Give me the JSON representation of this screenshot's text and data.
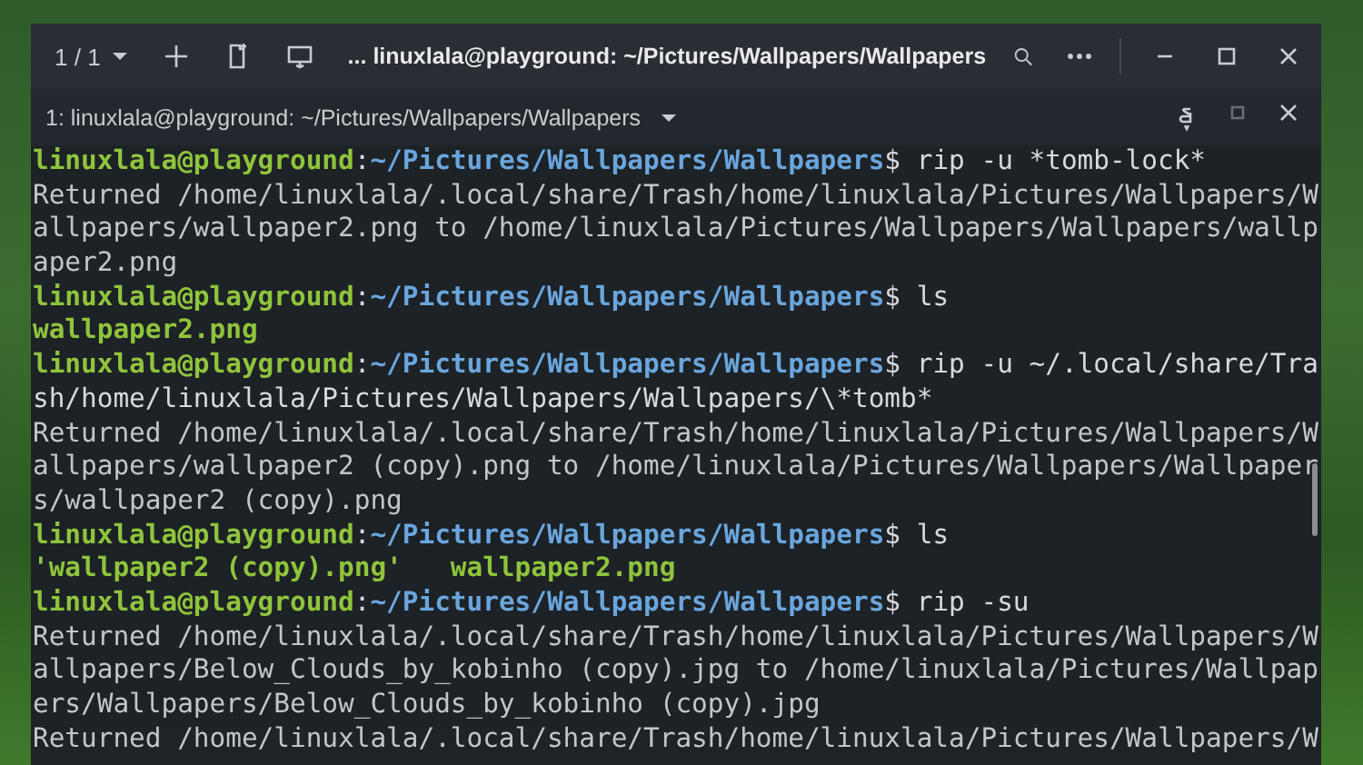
{
  "window": {
    "tab_counter": "1 / 1",
    "title": "... linuxlala@playground: ~/Pictures/Wallpapers/Wallpapers"
  },
  "tabs": [
    {
      "label": "1: linuxlala@playground: ~/Pictures/Wallpapers/Wallpapers",
      "selected": true
    }
  ],
  "terminal": {
    "lines": [
      [
        {
          "kind": "user",
          "text": "linuxlala@playground"
        },
        {
          "kind": "plain",
          "text": ":"
        },
        {
          "kind": "path",
          "text": "~/Pictures/Wallpapers/Wallpapers"
        },
        {
          "kind": "plain",
          "text": "$ rip -u *tomb-lock*"
        }
      ],
      [
        {
          "kind": "output",
          "text": "Returned /home/linuxlala/.local/share/Trash/home/linuxlala/Pictures/Wallpapers/W"
        }
      ],
      [
        {
          "kind": "output",
          "text": "allpapers/wallpaper2.png to /home/linuxlala/Pictures/Wallpapers/Wallpapers/wallp"
        }
      ],
      [
        {
          "kind": "output",
          "text": "aper2.png"
        }
      ],
      [
        {
          "kind": "user",
          "text": "linuxlala@playground"
        },
        {
          "kind": "plain",
          "text": ":"
        },
        {
          "kind": "path",
          "text": "~/Pictures/Wallpapers/Wallpapers"
        },
        {
          "kind": "plain",
          "text": "$ ls"
        }
      ],
      [
        {
          "kind": "file",
          "text": "wallpaper2.png"
        }
      ],
      [
        {
          "kind": "user",
          "text": "linuxlala@playground"
        },
        {
          "kind": "plain",
          "text": ":"
        },
        {
          "kind": "path",
          "text": "~/Pictures/Wallpapers/Wallpapers"
        },
        {
          "kind": "plain",
          "text": "$ rip -u ~/.local/share/Tra"
        }
      ],
      [
        {
          "kind": "plain",
          "text": "sh/home/linuxlala/Pictures/Wallpapers/Wallpapers/\\*tomb*"
        }
      ],
      [
        {
          "kind": "output",
          "text": "Returned /home/linuxlala/.local/share/Trash/home/linuxlala/Pictures/Wallpapers/W"
        }
      ],
      [
        {
          "kind": "output",
          "text": "allpapers/wallpaper2 (copy).png to /home/linuxlala/Pictures/Wallpapers/Wallpaper"
        }
      ],
      [
        {
          "kind": "output",
          "text": "s/wallpaper2 (copy).png"
        }
      ],
      [
        {
          "kind": "user",
          "text": "linuxlala@playground"
        },
        {
          "kind": "plain",
          "text": ":"
        },
        {
          "kind": "path",
          "text": "~/Pictures/Wallpapers/Wallpapers"
        },
        {
          "kind": "plain",
          "text": "$ ls"
        }
      ],
      [
        {
          "kind": "file",
          "text": "'wallpaper2 (copy).png'   wallpaper2.png"
        }
      ],
      [
        {
          "kind": "user",
          "text": "linuxlala@playground"
        },
        {
          "kind": "plain",
          "text": ":"
        },
        {
          "kind": "path",
          "text": "~/Pictures/Wallpapers/Wallpapers"
        },
        {
          "kind": "plain",
          "text": "$ rip -su"
        }
      ],
      [
        {
          "kind": "output",
          "text": "Returned /home/linuxlala/.local/share/Trash/home/linuxlala/Pictures/Wallpapers/W"
        }
      ],
      [
        {
          "kind": "output",
          "text": "allpapers/Below_Clouds_by_kobinho (copy).jpg to /home/linuxlala/Pictures/Wallpap"
        }
      ],
      [
        {
          "kind": "output",
          "text": "ers/Wallpapers/Below_Clouds_by_kobinho (copy).jpg"
        }
      ],
      [
        {
          "kind": "output",
          "text": "Returned /home/linuxlala/.local/share/Trash/home/linuxlala/Pictures/Wallpapers/W"
        }
      ]
    ]
  }
}
